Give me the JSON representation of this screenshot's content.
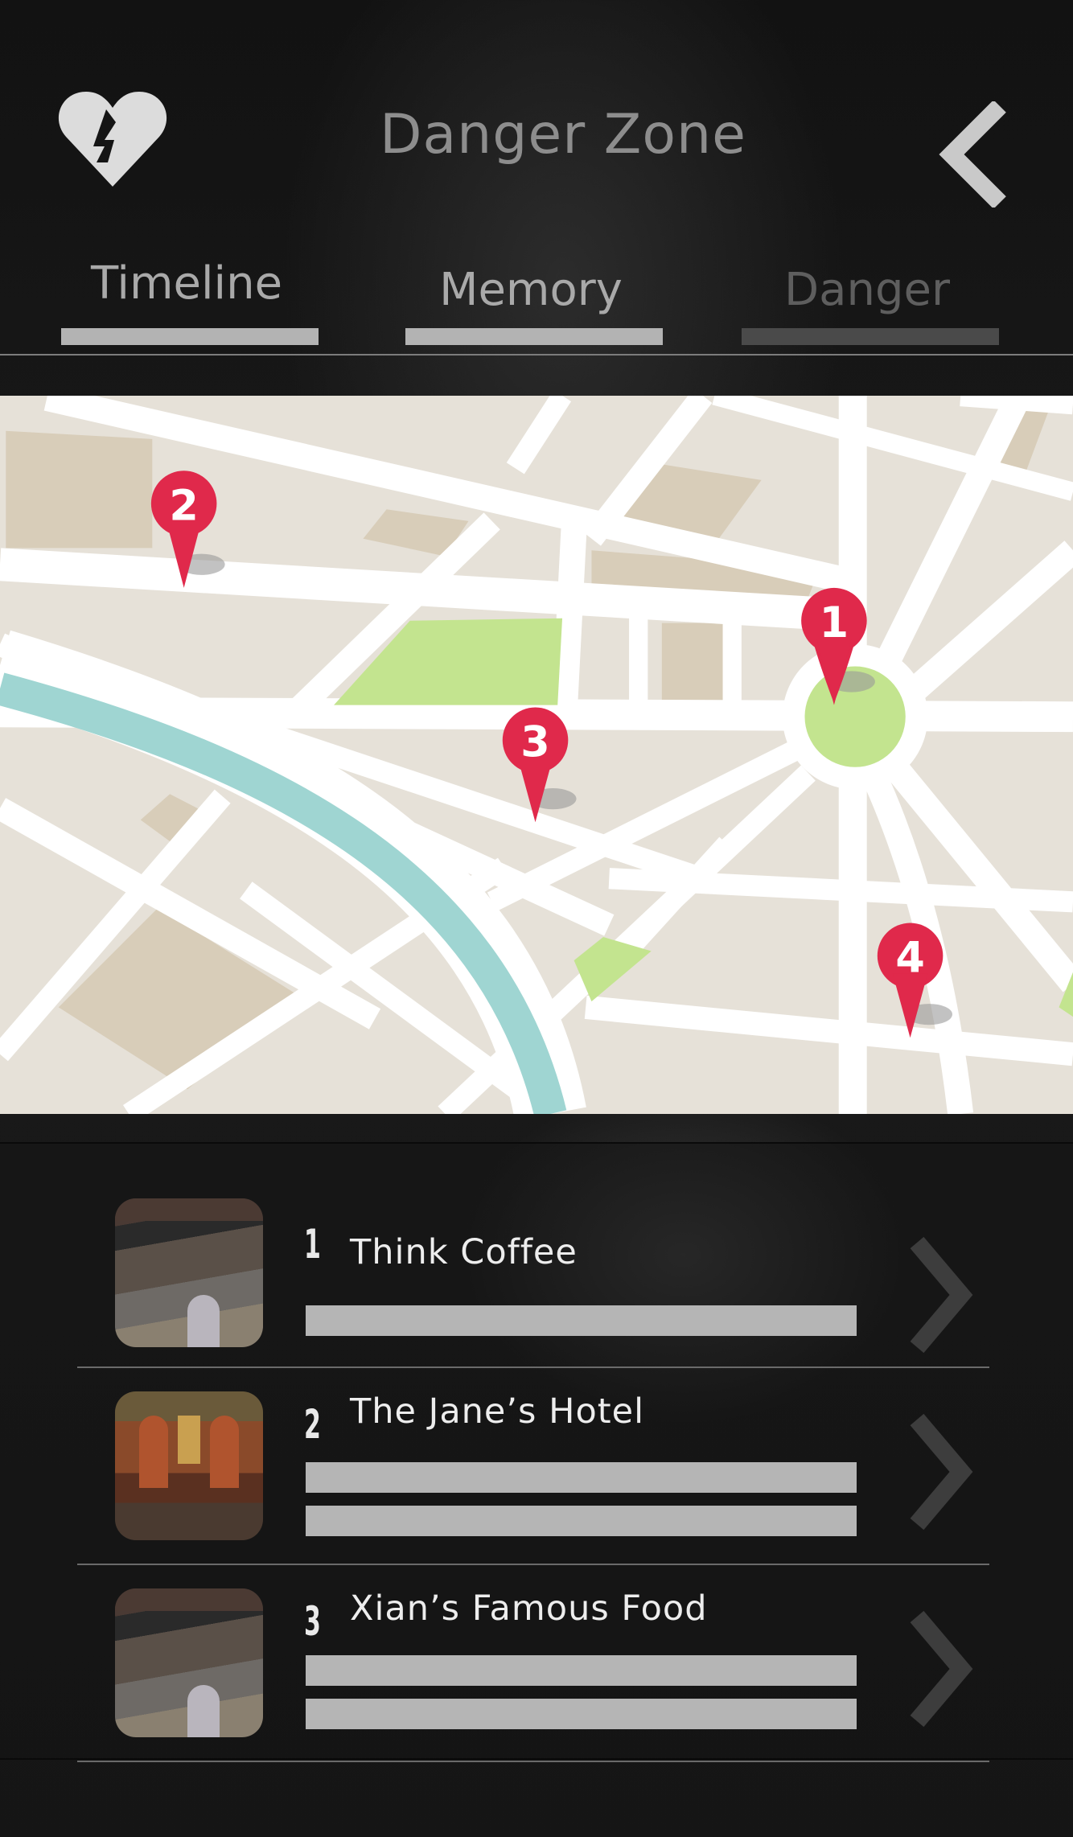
{
  "header": {
    "title": "Danger Zone",
    "left_icon": "broken-heart-icon",
    "right_icon": "chevron-left-icon"
  },
  "tabs": [
    {
      "label": "Timeline",
      "active": true
    },
    {
      "label": "Memory",
      "active": true
    },
    {
      "label": "Danger",
      "active": false
    }
  ],
  "map": {
    "pins": [
      {
        "label": "1"
      },
      {
        "label": "2"
      },
      {
        "label": "3"
      },
      {
        "label": "4"
      }
    ],
    "colors": {
      "pin": "#e0294b",
      "river": "#9fd5d2",
      "park": "#c3e48f",
      "block": "#d8cdb9",
      "land": "#e6e1d8"
    }
  },
  "places": [
    {
      "number": "1",
      "name": "Think Coffee",
      "thumbnail": "think coffee storefront photo"
    },
    {
      "number": "2",
      "name": "The Jane’s Hotel",
      "thumbnail": "hotel lobby photo"
    },
    {
      "number": "3",
      "name": "Xian’s Famous Food",
      "thumbnail": "think coffee storefront photo"
    }
  ]
}
